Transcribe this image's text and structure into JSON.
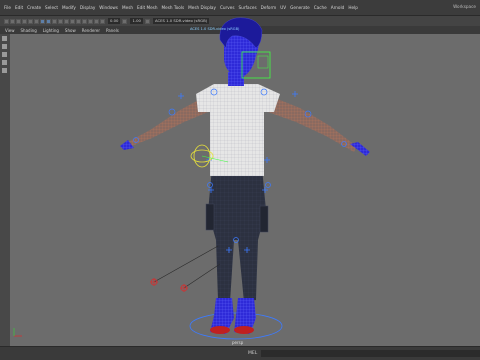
{
  "menubar": {
    "items": [
      "File",
      "Edit",
      "Create",
      "Select",
      "Modify",
      "Display",
      "Windows",
      "Mesh",
      "Edit Mesh",
      "Mesh Tools",
      "Mesh Display",
      "Curves",
      "Surfaces",
      "Deform",
      "UV",
      "Generate",
      "Cache",
      "Arnold",
      "Help"
    ],
    "window_title": "Workspace"
  },
  "toolbar": {
    "field1": "0.00",
    "field2": "1.00",
    "hud": "ACES 1.0 SDR-video (sRGB)"
  },
  "panel": {
    "menus": [
      "View",
      "Shading",
      "Lighting",
      "Show",
      "Renderer",
      "Panels"
    ]
  },
  "viewport": {
    "camera_label": "persp"
  },
  "status": {
    "mel_label": "MEL"
  },
  "colors": {
    "viewport_bg": "#6c6c6c",
    "wire_blue": "#2e2ad8",
    "shirt": "#e6e6e6",
    "pants": "#2c3140",
    "joint": "#3d7bff",
    "selection_green": "#40ff40",
    "locator_red": "#d43030"
  }
}
